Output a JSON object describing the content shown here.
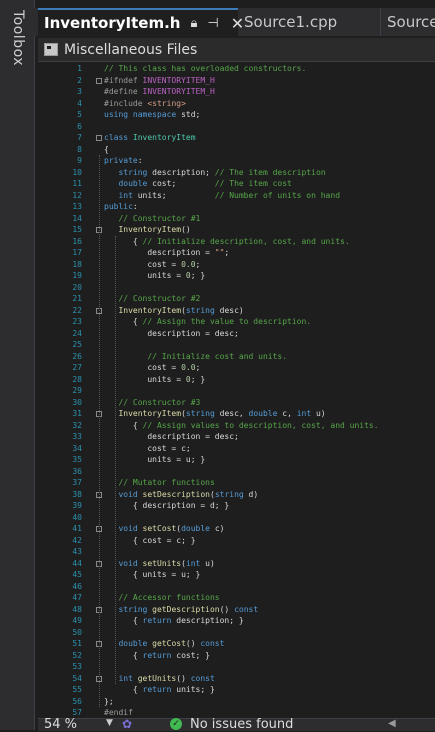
{
  "sidebar": {
    "toolbox_label": "Toolbox"
  },
  "tabs": [
    {
      "label": "InventoryItem.h",
      "active": true
    },
    {
      "label": "Source1.cpp",
      "active": false
    },
    {
      "label": "Source",
      "active": false
    }
  ],
  "navbar": {
    "scope": "Miscellaneous Files"
  },
  "status": {
    "zoom": "54 %",
    "issues": "No issues found"
  },
  "code_lines": [
    [
      [
        "cm",
        "// This class has overloaded constructors."
      ]
    ],
    [
      [
        "pp",
        "#ifndef "
      ],
      [
        "mac",
        "INVENTORYITEM_H"
      ]
    ],
    [
      [
        "pp",
        "#define "
      ],
      [
        "mac",
        "INVENTORYITEM_H"
      ]
    ],
    [
      [
        "pp",
        "#include "
      ],
      [
        "st",
        "<string>"
      ]
    ],
    [
      [
        "kw",
        "using namespace "
      ],
      [
        "id",
        "std;"
      ]
    ],
    [],
    [
      [
        "kw",
        "class "
      ],
      [
        "ty",
        "InventoryItem"
      ]
    ],
    [
      [
        "id",
        "{"
      ]
    ],
    [
      [
        "kw",
        "private"
      ],
      [
        "id",
        ":"
      ]
    ],
    [
      [
        "id",
        "   "
      ],
      [
        "kw",
        "string "
      ],
      [
        "id",
        "description; "
      ],
      [
        "cm",
        "// The item description"
      ]
    ],
    [
      [
        "id",
        "   "
      ],
      [
        "kw",
        "double "
      ],
      [
        "id",
        "cost;        "
      ],
      [
        "cm",
        "// The item cost"
      ]
    ],
    [
      [
        "id",
        "   "
      ],
      [
        "kw",
        "int "
      ],
      [
        "id",
        "units;          "
      ],
      [
        "cm",
        "// Number of units on hand"
      ]
    ],
    [
      [
        "kw",
        "public"
      ],
      [
        "id",
        ":"
      ]
    ],
    [
      [
        "id",
        "   "
      ],
      [
        "cm",
        "// Constructor #1"
      ]
    ],
    [
      [
        "id",
        "   "
      ],
      [
        "fn",
        "InventoryItem"
      ],
      [
        "id",
        "()"
      ]
    ],
    [
      [
        "id",
        "      { "
      ],
      [
        "cm",
        "// Initialize description, cost, and units."
      ]
    ],
    [
      [
        "id",
        "         description = "
      ],
      [
        "st",
        "\"\""
      ],
      [
        "id",
        ";"
      ]
    ],
    [
      [
        "id",
        "         cost = "
      ],
      [
        "nu",
        "0.0"
      ],
      [
        "id",
        ";"
      ]
    ],
    [
      [
        "id",
        "         units = "
      ],
      [
        "nu",
        "0"
      ],
      [
        "id",
        "; }"
      ]
    ],
    [],
    [
      [
        "id",
        "   "
      ],
      [
        "cm",
        "// Constructor #2"
      ]
    ],
    [
      [
        "id",
        "   "
      ],
      [
        "fn",
        "InventoryItem"
      ],
      [
        "id",
        "("
      ],
      [
        "kw",
        "string "
      ],
      [
        "id",
        "desc)"
      ]
    ],
    [
      [
        "id",
        "      { "
      ],
      [
        "cm",
        "// Assign the value to description."
      ]
    ],
    [
      [
        "id",
        "         description = desc;"
      ]
    ],
    [],
    [
      [
        "id",
        "         "
      ],
      [
        "cm",
        "// Initialize cost and units."
      ]
    ],
    [
      [
        "id",
        "         cost = "
      ],
      [
        "nu",
        "0.0"
      ],
      [
        "id",
        ";"
      ]
    ],
    [
      [
        "id",
        "         units = "
      ],
      [
        "nu",
        "0"
      ],
      [
        "id",
        "; }"
      ]
    ],
    [],
    [
      [
        "id",
        "   "
      ],
      [
        "cm",
        "// Constructor #3"
      ]
    ],
    [
      [
        "id",
        "   "
      ],
      [
        "fn",
        "InventoryItem"
      ],
      [
        "id",
        "("
      ],
      [
        "kw",
        "string "
      ],
      [
        "id",
        "desc, "
      ],
      [
        "kw",
        "double "
      ],
      [
        "id",
        "c, "
      ],
      [
        "kw",
        "int "
      ],
      [
        "id",
        "u)"
      ]
    ],
    [
      [
        "id",
        "      { "
      ],
      [
        "cm",
        "// Assign values to description, cost, and units."
      ]
    ],
    [
      [
        "id",
        "         description = desc;"
      ]
    ],
    [
      [
        "id",
        "         cost = c;"
      ]
    ],
    [
      [
        "id",
        "         units = u; }"
      ]
    ],
    [],
    [
      [
        "id",
        "   "
      ],
      [
        "cm",
        "// Mutator functions"
      ]
    ],
    [
      [
        "id",
        "   "
      ],
      [
        "kw",
        "void "
      ],
      [
        "fn",
        "setDescription"
      ],
      [
        "id",
        "("
      ],
      [
        "kw",
        "string "
      ],
      [
        "id",
        "d)"
      ]
    ],
    [
      [
        "id",
        "      { description = d; }"
      ]
    ],
    [],
    [
      [
        "id",
        "   "
      ],
      [
        "kw",
        "void "
      ],
      [
        "fn",
        "setCost"
      ],
      [
        "id",
        "("
      ],
      [
        "kw",
        "double "
      ],
      [
        "id",
        "c)"
      ]
    ],
    [
      [
        "id",
        "      { cost = c; }"
      ]
    ],
    [],
    [
      [
        "id",
        "   "
      ],
      [
        "kw",
        "void "
      ],
      [
        "fn",
        "setUnits"
      ],
      [
        "id",
        "("
      ],
      [
        "kw",
        "int "
      ],
      [
        "id",
        "u)"
      ]
    ],
    [
      [
        "id",
        "      { units = u; }"
      ]
    ],
    [],
    [
      [
        "id",
        "   "
      ],
      [
        "cm",
        "// Accessor functions"
      ]
    ],
    [
      [
        "id",
        "   "
      ],
      [
        "kw",
        "string "
      ],
      [
        "fn",
        "getDescription"
      ],
      [
        "id",
        "() "
      ],
      [
        "kw",
        "const"
      ]
    ],
    [
      [
        "id",
        "      { "
      ],
      [
        "kw",
        "return "
      ],
      [
        "id",
        "description; }"
      ]
    ],
    [],
    [
      [
        "id",
        "   "
      ],
      [
        "kw",
        "double "
      ],
      [
        "fn",
        "getCost"
      ],
      [
        "id",
        "() "
      ],
      [
        "kw",
        "const"
      ]
    ],
    [
      [
        "id",
        "      { "
      ],
      [
        "kw",
        "return "
      ],
      [
        "id",
        "cost; }"
      ]
    ],
    [],
    [
      [
        "id",
        "   "
      ],
      [
        "kw",
        "int "
      ],
      [
        "fn",
        "getUnits"
      ],
      [
        "id",
        "() "
      ],
      [
        "kw",
        "const"
      ]
    ],
    [
      [
        "id",
        "      { "
      ],
      [
        "kw",
        "return "
      ],
      [
        "id",
        "units; }"
      ]
    ],
    [
      [
        "id",
        "};"
      ]
    ],
    [
      [
        "pp",
        "#endif"
      ]
    ]
  ]
}
